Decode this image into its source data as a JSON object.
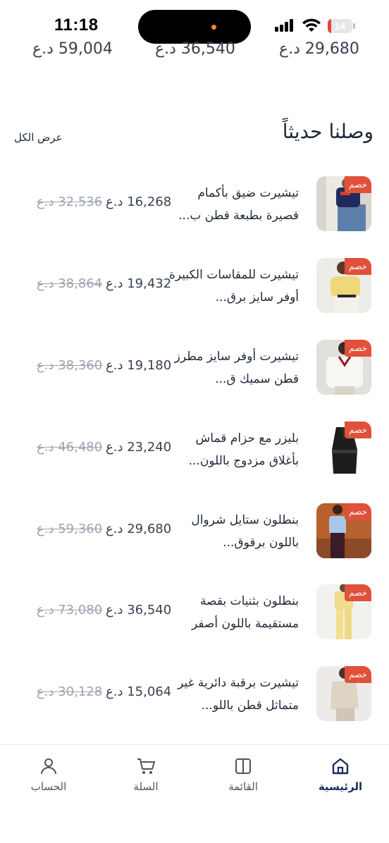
{
  "status_bar": {
    "time": "11:18",
    "battery": "14",
    "battery_level": 0.14
  },
  "cutoff_prices": [
    "59,004 د.ع",
    "36,540 د.ع",
    "29,680 د.ع"
  ],
  "section": {
    "title": "وصلنا حديثاً",
    "view_all": "عرض الكل"
  },
  "products": [
    {
      "name": "تيشيرت ضيق بأكمام قصيرة بطبعة قطن ب...",
      "price": "16,268 د.ع",
      "old_price": "32,536 د.ع",
      "badge": "خصم",
      "image": "navy-crop-tee-jeans"
    },
    {
      "name": "تيشيرت للمقاسات الكبيرة أوفر سايز برق...",
      "price": "19,432 د.ع",
      "old_price": "38,864 د.ع",
      "badge": "خصم",
      "image": "yellow-oversized-tee"
    },
    {
      "name": "تيشيرت أوفر سايز مطرز قطن سميك ق...",
      "price": "19,180 د.ع",
      "old_price": "38,360 د.ع",
      "badge": "خصم",
      "image": "white-polo-tee"
    },
    {
      "name": "بليزر مع حزام قماش بأغلاق مزدوج باللون...",
      "price": "23,240 د.ع",
      "old_price": "46,480 د.ع",
      "badge": "خصم",
      "image": "black-belted-blazer"
    },
    {
      "name": "بنطلون ستايل شروال باللون برقوق...",
      "price": "29,680 د.ع",
      "old_price": "59,360 د.ع",
      "badge": "خصم",
      "image": "plum-trousers"
    },
    {
      "name": "بنطلون بثنيات بقصة مستقيمة باللون أصفر",
      "price": "36,540 د.ع",
      "old_price": "73,080 د.ع",
      "badge": "خصم",
      "image": "yellow-pleated-trousers"
    },
    {
      "name": "تيشيرت برقبة دائرية غير متماثل قطن باللو...",
      "price": "15,064 د.ع",
      "old_price": "30,128 د.ع",
      "badge": "خصم",
      "image": "beige-asymmetric-top"
    }
  ],
  "nav": {
    "home": {
      "label": "الرئيسية",
      "icon": "home-icon"
    },
    "catalog": {
      "label": "القائمة",
      "icon": "catalog-icon"
    },
    "cart": {
      "label": "السلة",
      "icon": "cart-icon"
    },
    "account": {
      "label": "الحساب",
      "icon": "user-icon"
    }
  },
  "colors": {
    "badge": "#e0503a",
    "active_nav": "#1e2a5a",
    "text": "#1f2937",
    "old_price": "#9ca3af"
  }
}
